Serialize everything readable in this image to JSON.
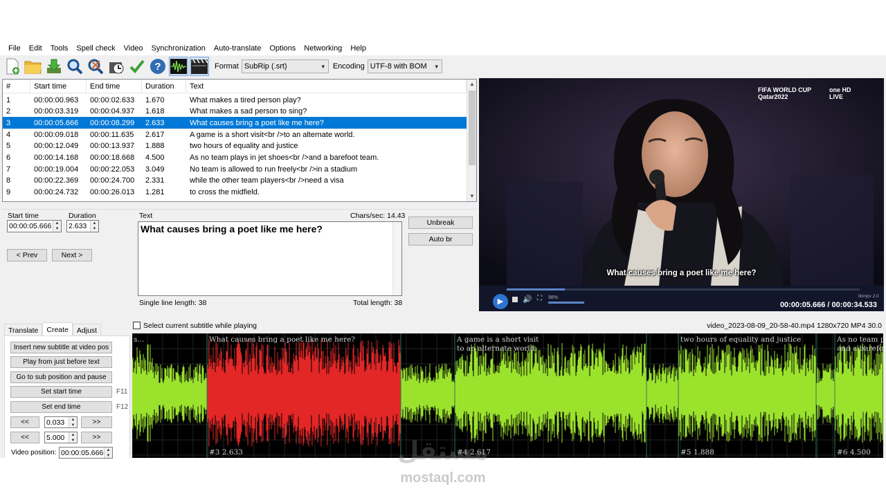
{
  "menu": [
    "File",
    "Edit",
    "Tools",
    "Spell check",
    "Video",
    "Synchronization",
    "Auto-translate",
    "Options",
    "Networking",
    "Help"
  ],
  "toolbar": {
    "icons": [
      "new-file-icon",
      "open-folder-icon",
      "download-icon",
      "find-icon",
      "replace-icon",
      "visual-sync-icon",
      "spell-check-icon",
      "help-icon",
      "waveform-icon",
      "video-icon"
    ],
    "format_label": "Format",
    "format_value": "SubRip (.srt)",
    "encoding_label": "Encoding",
    "encoding_value": "UTF-8 with BOM"
  },
  "grid": {
    "headers": [
      "#",
      "Start time",
      "End time",
      "Duration",
      "Text"
    ],
    "rows": [
      [
        "1",
        "00:00:00.963",
        "00:00:02.633",
        "1.670",
        "What makes a tired person play?"
      ],
      [
        "2",
        "00:00:03.319",
        "00:00:04.937",
        "1.618",
        "What makes a sad person to sing?"
      ],
      [
        "3",
        "00:00:05.666",
        "00:00:08.299",
        "2.633",
        "What causes bring a poet like me here?"
      ],
      [
        "4",
        "00:00:09.018",
        "00:00:11.635",
        "2.617",
        "A game is a short visit<br />to an alternate world."
      ],
      [
        "5",
        "00:00:12.049",
        "00:00:13.937",
        "1.888",
        "two hours of equality and justice"
      ],
      [
        "6",
        "00:00:14.168",
        "00:00:18.668",
        "4.500",
        "As no team plays in jet shoes<br />and a barefoot team."
      ],
      [
        "7",
        "00:00:19.004",
        "00:00:22.053",
        "3.049",
        "No team is allowed to run freely<br />in a stadium"
      ],
      [
        "8",
        "00:00:22.369",
        "00:00:24.700",
        "2.331",
        "while the other team players<br />need a visa"
      ],
      [
        "9",
        "00:00:24.732",
        "00:00:26.013",
        "1.281",
        "to cross the midfield."
      ]
    ],
    "selected_index": 2
  },
  "edit": {
    "start_label": "Start time",
    "start_value": "00:00:05.666",
    "duration_label": "Duration",
    "duration_value": "2.633",
    "text_label": "Text",
    "chars_sec": "Chars/sec: 14.43",
    "text_value": "What causes bring a poet like me here?",
    "prev": "< Prev",
    "next": "Next >",
    "unbreak": "Unbreak",
    "auto_br": "Auto br",
    "single_line": "Single line length: 38",
    "total_length": "Total length: 38"
  },
  "video": {
    "subtitle": "What causes bring a poet like me here?",
    "broadcast_logo": "FIFA WORLD CUP Qatar2022",
    "channel_logo": "one HD LIVE",
    "time": "00:00:05.666 / 00:00:34.533",
    "volume": "98%",
    "player_name": "libmpv 2.0",
    "progress": 0.164
  },
  "lower": {
    "tabs": [
      "Translate",
      "Create",
      "Adjust"
    ],
    "active_tab": "Create",
    "select_while_playing": "Select current subtitle while playing",
    "file_info": "video_2023-08-09_20-58-40.mp4 1280x720 MP4 30.0",
    "buttons": [
      "Insert new subtitle at video pos",
      "Play from just before text",
      "Go to sub position and pause",
      "Set start time",
      "Set end time"
    ],
    "f11": "F11",
    "f12": "F12",
    "back": "<<",
    "fwd": ">>",
    "step1": "0.033",
    "step2": "5.000",
    "video_position_label": "Video position:",
    "video_position": "00:00:05.666"
  },
  "waveform": {
    "labels": [
      {
        "text": "What causes bring a poet like me here?",
        "id": "#3  2.633"
      },
      {
        "text": "A game is a short visit / to an alternate world.",
        "id": "#4  2.617"
      },
      {
        "text": "two hours of equality and justice",
        "id": "#5  1.888"
      },
      {
        "text": "As no team p... / and a barefo...",
        "id": "#6  4.500"
      }
    ],
    "colors": {
      "normal": "#9be22d",
      "selected": "#e32626",
      "background": "#000000"
    }
  },
  "watermark": {
    "arabic": "مستقل",
    "latin": "mostaql.com"
  }
}
